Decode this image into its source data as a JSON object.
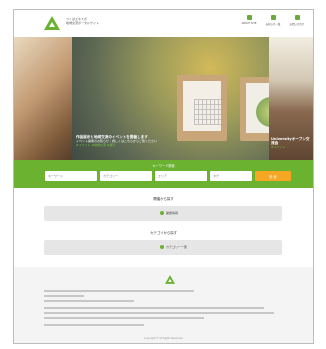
{
  "brand": {
    "line1": "つくばエキスポ",
    "line2": "地域交流ポータルサイト",
    "color": "#6ab230"
  },
  "nav": [
    {
      "label": "ABOUT SITE",
      "icon": "info-icon"
    },
    {
      "label": "お知らせ一覧",
      "icon": "news-icon"
    },
    {
      "label": "お問い合わせ",
      "icon": "mail-icon"
    }
  ],
  "hero": {
    "center_title": "作品展示と地域交流のイベントを開催します",
    "center_sub": "イベント開催のお知らせ｜詳しくはこちらからご覧ください",
    "center_tag": "#イベント  #地域交流  #展示",
    "right_title": "Universityオープン交流会",
    "right_tag": "#イベント"
  },
  "search": {
    "title": "キーワード検索",
    "placeholders": [
      "キーワード",
      "カテゴリー",
      "エリア",
      "タグ"
    ],
    "button": "検 索"
  },
  "sections": [
    {
      "title": "開催から探す",
      "pill": "開催情報"
    },
    {
      "title": "カテゴリから探す",
      "pill": "カテゴリー一覧"
    }
  ],
  "footer": {
    "copyright": "Copyright © All Rights Reserved."
  }
}
